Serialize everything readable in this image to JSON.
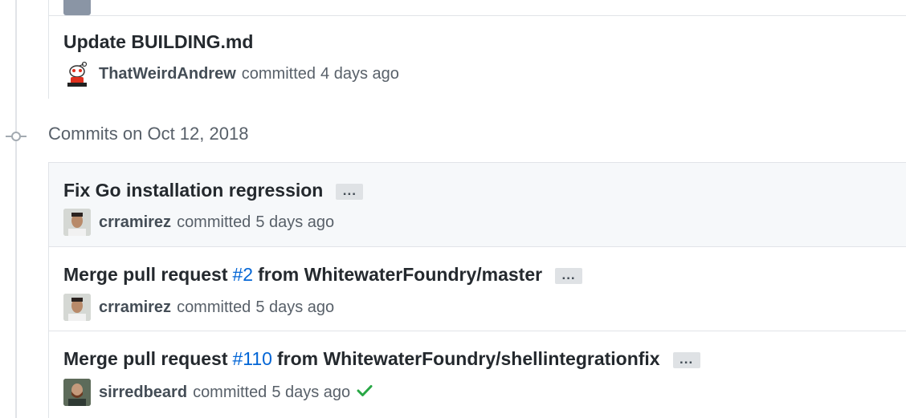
{
  "top_group": {
    "commits": [
      {
        "title": "Update BUILDING.md",
        "author": "ThatWeirdAndrew",
        "action": "committed",
        "time": "4 days ago"
      }
    ]
  },
  "date_group": {
    "heading": "Commits on Oct 12, 2018",
    "commits": [
      {
        "title": "Fix Go installation regression",
        "author": "crramirez",
        "action": "committed",
        "time": "5 days ago",
        "more_label": "..."
      },
      {
        "title_prefix": "Merge pull request",
        "pr": "#2",
        "title_suffix": "from WhitewaterFoundry/master",
        "author": "crramirez",
        "action": "committed",
        "time": "5 days ago",
        "more_label": "..."
      },
      {
        "title_prefix": "Merge pull request",
        "pr": "#110",
        "title_suffix": "from WhitewaterFoundry/shellintegrationfix",
        "author": "sirredbeard",
        "action": "committed",
        "time": "5 days ago",
        "more_label": "...",
        "status": "success"
      }
    ]
  },
  "colors": {
    "link": "#0366d6",
    "success": "#28a745",
    "highlight_row": "#f6f8fa",
    "border": "#e1e4e8"
  },
  "icons": {
    "timeline_node": "git-commit-icon",
    "status": "check-icon",
    "more": "ellipsis-icon"
  }
}
